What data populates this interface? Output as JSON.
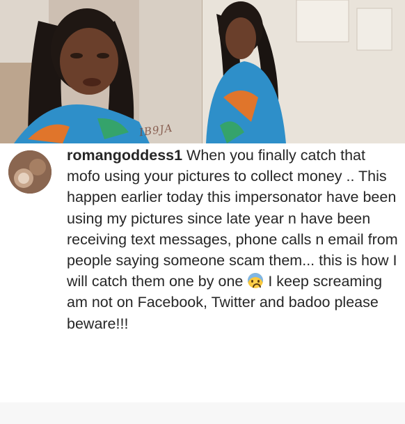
{
  "post": {
    "watermark": "IB9JA",
    "caption": {
      "username": "romangoddess1",
      "text_before_emoji": " When you finally catch that mofo using your pictures to collect money .. This happen earlier today this impersonator have been using my pictures since late year n have been receiving text messages, phone calls n email from people saying someone scam them... this is how I will catch them one by one ",
      "emoji": "fearful-face-emoji",
      "text_after_emoji": " I keep screaming am not on Facebook, Twitter and badoo please beware!!!"
    }
  },
  "colors": {
    "text": "#262626",
    "background": "#ffffff",
    "outfit_blue": "#2e8fc9",
    "outfit_orange": "#e0752b"
  }
}
